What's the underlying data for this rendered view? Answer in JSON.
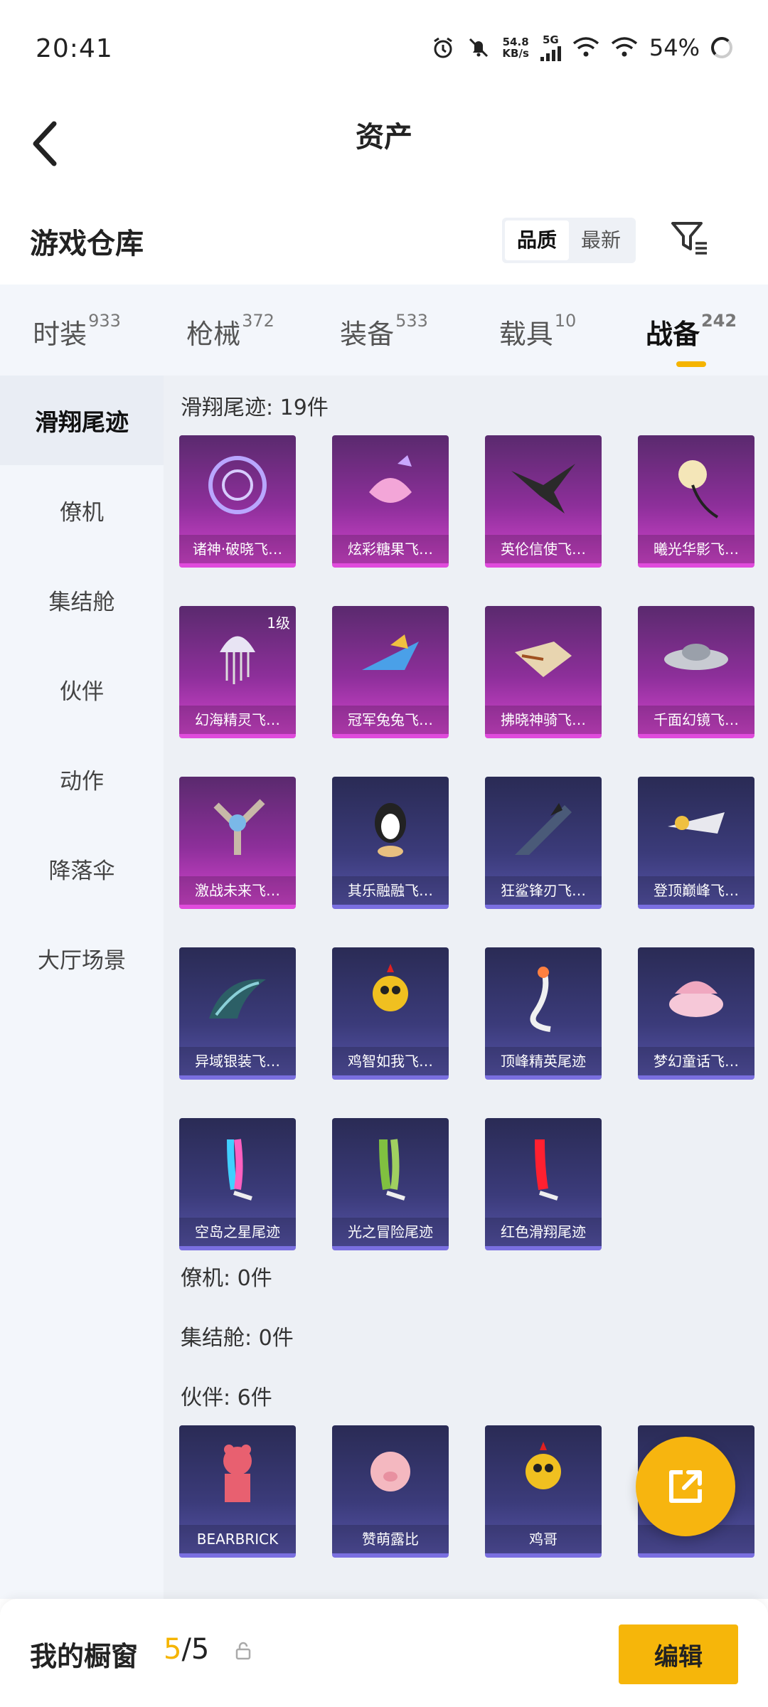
{
  "status": {
    "time": "20:41",
    "net_speed": "54.8",
    "net_unit": "KB/s",
    "network": "5G",
    "battery": "54%"
  },
  "header": {
    "title": "资产"
  },
  "subhead": {
    "label": "游戏仓库",
    "sort_options": [
      "品质",
      "最新"
    ],
    "sort_selected": "品质"
  },
  "tabs": [
    {
      "label": "时装",
      "count": "933"
    },
    {
      "label": "枪械",
      "count": "372"
    },
    {
      "label": "装备",
      "count": "533"
    },
    {
      "label": "载具",
      "count": "10"
    },
    {
      "label": "战备",
      "count": "242"
    }
  ],
  "active_tab": "战备",
  "sidebar": {
    "items": [
      "滑翔尾迹",
      "僚机",
      "集结舱",
      "伙伴",
      "动作",
      "降落伞",
      "大厅场景"
    ],
    "active": "滑翔尾迹"
  },
  "sections": [
    {
      "title": "滑翔尾迹: 19件",
      "items": [
        {
          "name": "诸神·破晓飞…",
          "tier": "purple",
          "icon": "rune-disc-icon"
        },
        {
          "name": "炫彩糖果飞…",
          "tier": "purple",
          "icon": "candy-icon"
        },
        {
          "name": "英伦信使飞…",
          "tier": "purple",
          "icon": "raven-icon"
        },
        {
          "name": "曦光华影飞…",
          "tier": "purple",
          "icon": "flower-icon"
        },
        {
          "name": "幻海精灵飞…",
          "tier": "purple",
          "icon": "jellyfish-icon",
          "level": "1级"
        },
        {
          "name": "冠军兔兔飞…",
          "tier": "purple",
          "icon": "jet-icon"
        },
        {
          "name": "拂晓神骑飞…",
          "tier": "purple",
          "icon": "glider-icon"
        },
        {
          "name": "千面幻镜飞…",
          "tier": "purple",
          "icon": "ufo-icon"
        },
        {
          "name": "激战未来飞…",
          "tier": "purple",
          "icon": "drone-icon"
        },
        {
          "name": "其乐融融飞…",
          "tier": "blue",
          "icon": "penguin-icon"
        },
        {
          "name": "狂鲨锋刃飞…",
          "tier": "blue",
          "icon": "shark-icon"
        },
        {
          "name": "登顶巅峰飞…",
          "tier": "blue",
          "icon": "plane-icon"
        },
        {
          "name": "异域银装飞…",
          "tier": "blue",
          "icon": "wing-icon"
        },
        {
          "name": "鸡智如我飞…",
          "tier": "blue",
          "icon": "chicken-icon"
        },
        {
          "name": "顶峰精英尾迹",
          "tier": "blue",
          "icon": "trail-icon"
        },
        {
          "name": "梦幻童话飞…",
          "tier": "blue",
          "icon": "carriage-icon"
        },
        {
          "name": "空岛之星尾迹",
          "tier": "blue",
          "icon": "rainbow-trail-icon"
        },
        {
          "name": "光之冒险尾迹",
          "tier": "blue",
          "icon": "green-trail-icon"
        },
        {
          "name": "红色滑翔尾迹",
          "tier": "blue",
          "icon": "red-trail-icon"
        }
      ]
    },
    {
      "title": "僚机: 0件",
      "items": []
    },
    {
      "title": "集结舱: 0件",
      "items": []
    },
    {
      "title": "伙伴: 6件",
      "items": [
        {
          "name": "BEARBRICK",
          "tier": "blue",
          "icon": "bear-icon"
        },
        {
          "name": "赞萌露比",
          "tier": "blue",
          "icon": "pig-icon"
        },
        {
          "name": "鸡哥",
          "tier": "blue",
          "icon": "chicken-icon"
        },
        {
          "name": "",
          "tier": "blue",
          "icon": "partner-icon"
        }
      ]
    }
  ],
  "bottom": {
    "label": "我的橱窗",
    "current": "5",
    "total": "/5",
    "edit_label": "编辑"
  },
  "colors": {
    "accent": "#f5b400",
    "purple_tier": "#d044cc",
    "blue_tier": "#5553a6"
  }
}
